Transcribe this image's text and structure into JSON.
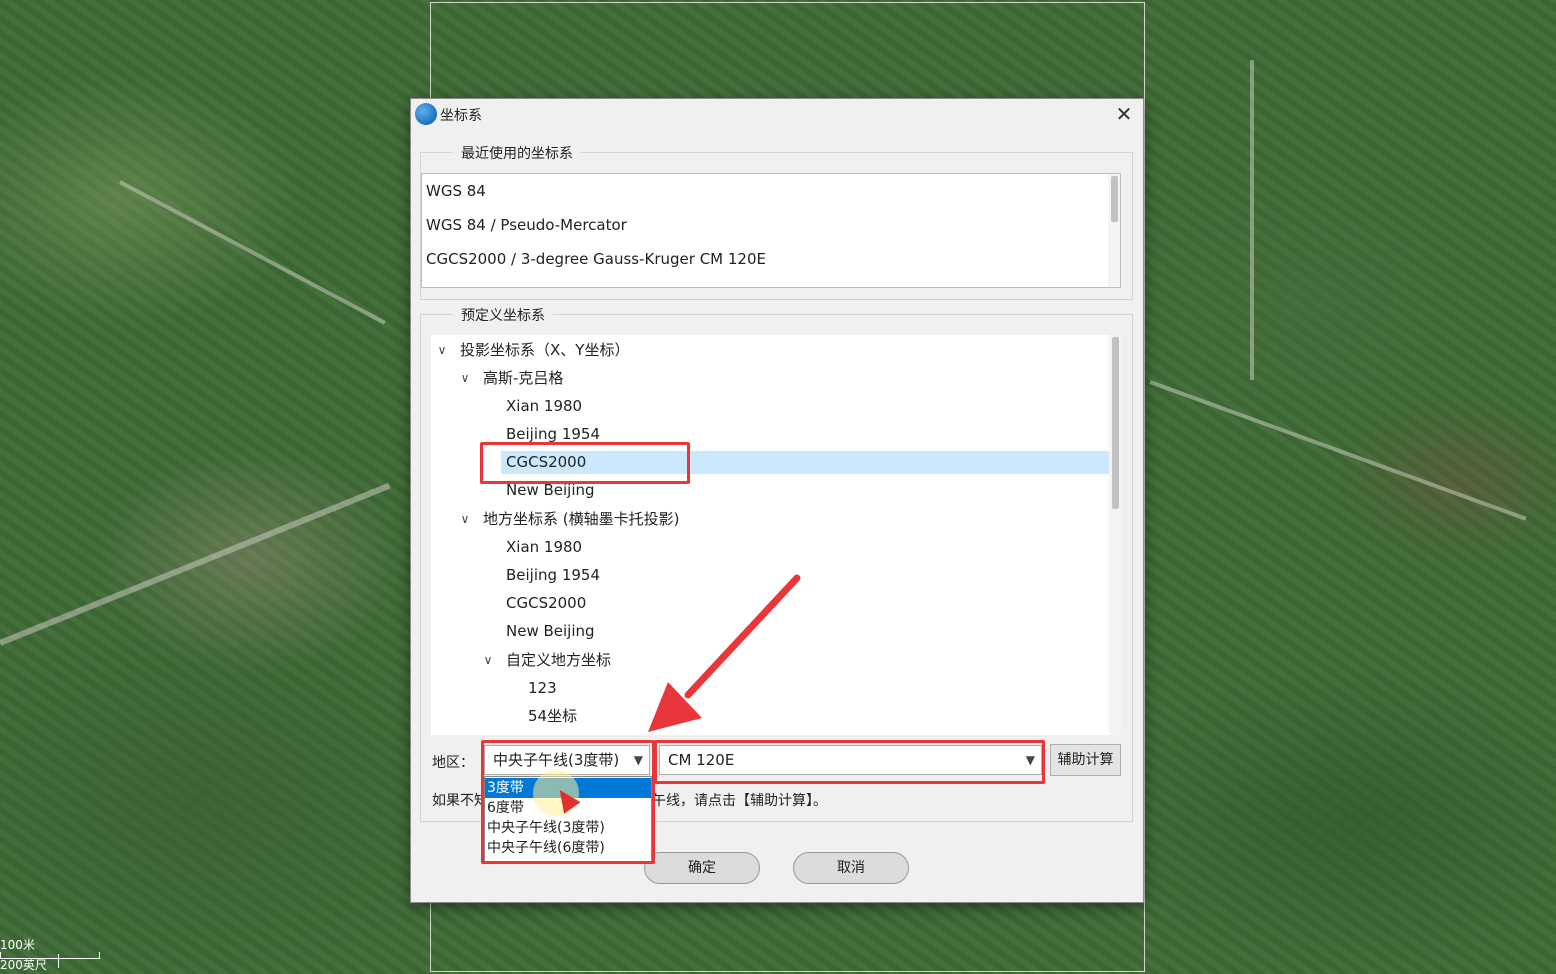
{
  "map": {
    "scale_metric": "100米",
    "scale_imperial": "200英尺"
  },
  "dialog": {
    "title": "坐标系",
    "close_glyph": "✕",
    "recent": {
      "label": "最近使用的坐标系",
      "items": [
        "WGS 84",
        "WGS 84 / Pseudo-Mercator",
        "CGCS2000 / 3-degree Gauss-Kruger CM 120E"
      ]
    },
    "predefined": {
      "label": "预定义坐标系",
      "tree": [
        {
          "text": "投影坐标系（X、Y坐标）",
          "chevron": "∨"
        },
        {
          "text": "高斯-克吕格",
          "chevron": "∨"
        },
        {
          "text": "Xian 1980"
        },
        {
          "text": "Beijing 1954"
        },
        {
          "text": "CGCS2000"
        },
        {
          "text": "New Beijing"
        },
        {
          "text": "地方坐标系 (横轴墨卡托投影)",
          "chevron": "∨"
        },
        {
          "text": "Xian 1980"
        },
        {
          "text": "Beijing 1954"
        },
        {
          "text": "CGCS2000"
        },
        {
          "text": "New Beijing"
        },
        {
          "text": "自定义地方坐标",
          "chevron": "∨"
        },
        {
          "text": "123"
        },
        {
          "text": "54坐标"
        }
      ]
    },
    "region": {
      "label": "地区：",
      "zone_type_selected": "中央子午线(3度带)",
      "meridian_selected": "CM 120E",
      "assist_button": "辅助计算",
      "dropdown_options": [
        "3度带",
        "6度带",
        "中央子午线(3度带)",
        "中央子午线(6度带)"
      ]
    },
    "hint_left": "如果不知",
    "hint_right": "午线，请点击【辅助计算】。",
    "ok_button": "确定",
    "cancel_button": "取消"
  }
}
